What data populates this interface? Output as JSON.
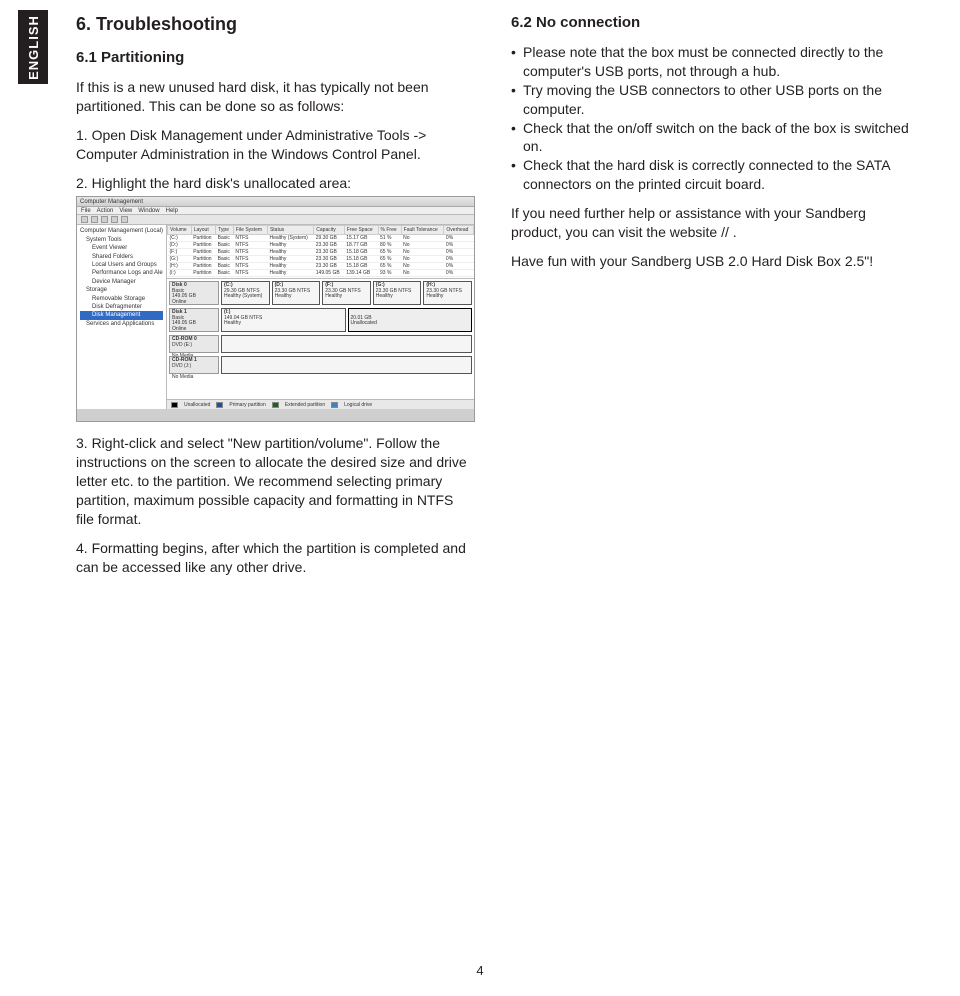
{
  "language_tab": "ENGLISH",
  "left": {
    "h2": "6. Troubleshooting",
    "h3": "6.1 Partitioning",
    "p1": "If this is a new unused hard disk, it has typically not been partitioned. This can be done so as follows:",
    "step1": "1. Open Disk Management under Administrative Tools -> Computer Administration in the Windows Control Panel.",
    "step2": "2. Highlight the hard disk's unallocated area:",
    "step3": "3. Right-click and select \"New partition/volume\". Follow the instructions on the screen to allocate the desired size and drive letter etc. to the partition. We recommend selecting primary partition, maximum possible capacity and formatting in NTFS file format.",
    "step4": "4. Formatting begins, after which the partition is completed and can be accessed like any other drive."
  },
  "right": {
    "h3": "6.2 No connection",
    "b1": "Please note that the box must be connected directly to the computer's USB ports, not through a hub.",
    "b2": "Try moving the USB connectors to other USB ports on the computer.",
    "b3": "Check that the on/off switch on the back of the box is switched on.",
    "b4": "Check that the hard disk is correctly connected to the SATA connectors on the printed circuit board.",
    "p_help": "If you need further help or assistance with your Sandberg product, you can visit the website       //                                   .",
    "p_fun": "Have fun with your Sandberg USB 2.0 Hard Disk Box 2.5\"!"
  },
  "screenshot": {
    "title": "Computer Management",
    "menu": [
      "File",
      "Action",
      "View",
      "Window",
      "Help"
    ],
    "tree": {
      "root": "Computer Management (Local)",
      "items": [
        "System Tools",
        "Event Viewer",
        "Shared Folders",
        "Local Users and Groups",
        "Performance Logs and Alerts",
        "Device Manager",
        "Storage",
        "Removable Storage",
        "Disk Defragmenter",
        "Disk Management",
        "Services and Applications"
      ]
    },
    "grid": {
      "headers": [
        "Volume",
        "Layout",
        "Type",
        "File System",
        "Status",
        "Capacity",
        "Free Space",
        "% Free",
        "Fault Tolerance",
        "Overhead"
      ],
      "rows": [
        [
          "(C:)",
          "Partition",
          "Basic",
          "NTFS",
          "Healthy (System)",
          "29.30 GB",
          "15.17 GB",
          "51 %",
          "No",
          "0%"
        ],
        [
          "(D:)",
          "Partition",
          "Basic",
          "NTFS",
          "Healthy",
          "23.30 GB",
          "18.77 GB",
          "80 %",
          "No",
          "0%"
        ],
        [
          "(F:)",
          "Partition",
          "Basic",
          "NTFS",
          "Healthy",
          "23.30 GB",
          "15.18 GB",
          "65 %",
          "No",
          "0%"
        ],
        [
          "(G:)",
          "Partition",
          "Basic",
          "NTFS",
          "Healthy",
          "23.30 GB",
          "15.18 GB",
          "65 %",
          "No",
          "0%"
        ],
        [
          "(H:)",
          "Partition",
          "Basic",
          "NTFS",
          "Healthy",
          "23.30 GB",
          "15.18 GB",
          "65 %",
          "No",
          "0%"
        ],
        [
          "(I:)",
          "Partition",
          "Basic",
          "NTFS",
          "Healthy",
          "149.05 GB",
          "139.14 GB",
          "93 %",
          "No",
          "0%"
        ]
      ]
    },
    "disks": [
      {
        "label": "Disk 0",
        "sub": "Basic",
        "size": "149.05 GB",
        "state": "Online",
        "parts": [
          {
            "t": "(C:)",
            "s": "29.30 GB NTFS",
            "st": "Healthy (System)"
          },
          {
            "t": "(D:)",
            "s": "23.30 GB NTFS",
            "st": "Healthy"
          },
          {
            "t": "(F:)",
            "s": "23.30 GB NTFS",
            "st": "Healthy"
          },
          {
            "t": "(G:)",
            "s": "23.30 GB NTFS",
            "st": "Healthy"
          },
          {
            "t": "(H:)",
            "s": "23.30 GB NTFS",
            "st": "Healthy"
          }
        ]
      },
      {
        "label": "Disk 1",
        "sub": "Basic",
        "size": "149.05 GB",
        "state": "Online",
        "parts": [
          {
            "t": "(I:)",
            "s": "149.04 GB NTFS",
            "st": "Healthy"
          },
          {
            "t": "",
            "s": "20.01 GB",
            "st": "Unallocated"
          }
        ]
      },
      {
        "label": "CD-ROM 0",
        "sub": "DVD (E:)",
        "size": "",
        "state": "No Media",
        "parts": []
      },
      {
        "label": "CD-ROM 1",
        "sub": "DVD (J:)",
        "size": "",
        "state": "No Media",
        "parts": []
      }
    ],
    "legend": [
      "Unallocated",
      "Primary partition",
      "Extended partition",
      "Logical drive"
    ]
  },
  "page_number": "4"
}
